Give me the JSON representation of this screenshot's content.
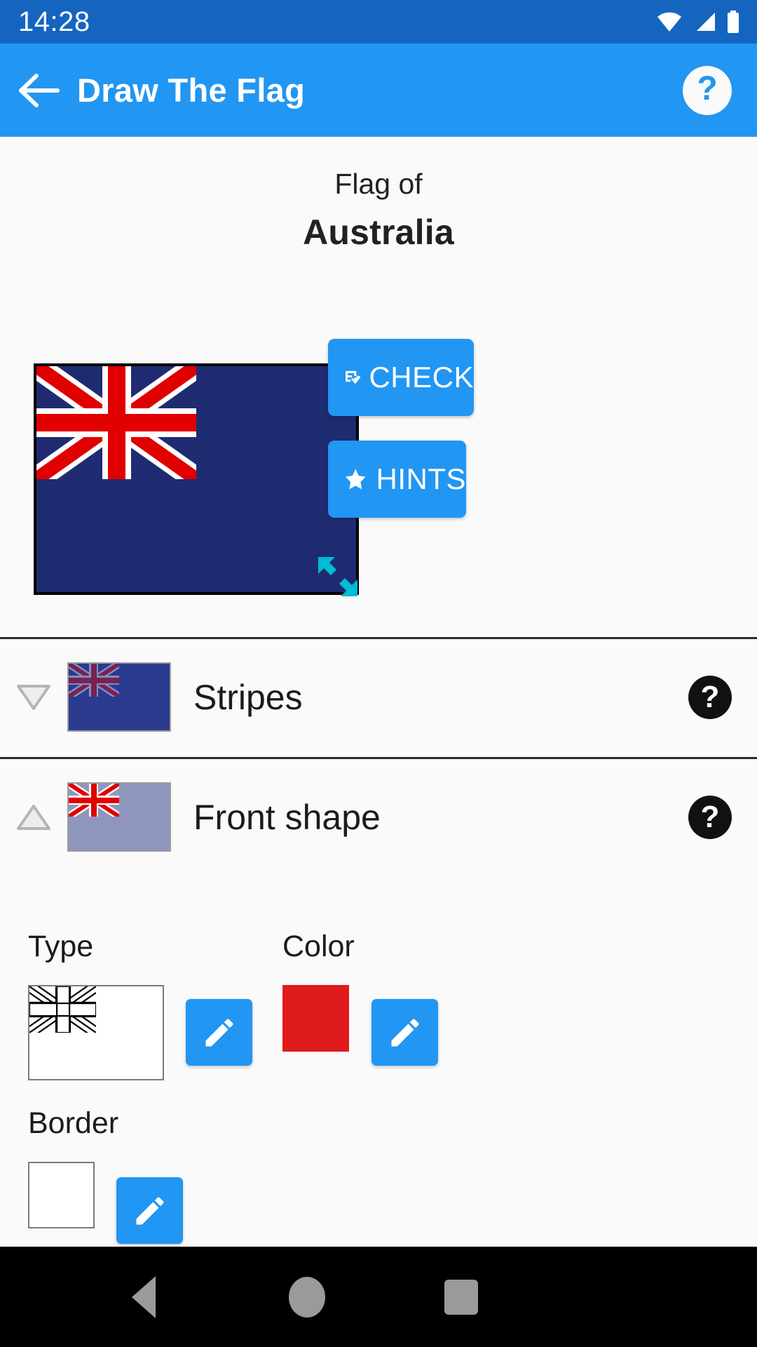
{
  "status_bar": {
    "time": "14:28",
    "icons": [
      "wifi-icon",
      "cellular-signal-icon",
      "battery-icon"
    ]
  },
  "app_bar": {
    "back_icon": "arrow-left-icon",
    "title": "Draw The Flag",
    "help_icon": "question-mark-icon",
    "background_color": "#2196F3"
  },
  "header": {
    "prefix": "Flag of",
    "country": "Australia"
  },
  "canvas": {
    "name": "flag-drawing-canvas",
    "background_color": "#1F2B70",
    "border_color": "#000000",
    "union_jack_red": "#E00000",
    "union_jack_white": "#FFFFFF"
  },
  "actions": {
    "check": {
      "label": "CHECK",
      "icon": "fact-check-icon",
      "color": "#2196F3"
    },
    "hints": {
      "label": "HINTS",
      "icon": "star-icon",
      "color": "#2196F3"
    },
    "resize": {
      "icon": "resize-diagonal-icon",
      "color": "#00BCD4"
    }
  },
  "sections": [
    {
      "id": "stripes",
      "label": "Stripes",
      "chevron": "chevron-down-icon",
      "expanded": false,
      "help_icon": "question-mark-icon",
      "thumb_background": "#2A3B8F",
      "thumb_overlay_opacity": 0.45
    },
    {
      "id": "front-shape",
      "label": "Front shape",
      "chevron": "chevron-up-icon",
      "expanded": true,
      "help_icon": "question-mark-icon",
      "thumb_background": "#8F96BE",
      "thumb_overlay_opacity": 1
    }
  ],
  "front_shape_properties": [
    {
      "id": "type",
      "label": "Type",
      "preview": "union-jack-outline",
      "preview_background": "#FFFFFF",
      "edit_icon": "pencil-icon"
    },
    {
      "id": "color",
      "label": "Color",
      "value": "#E01B1B",
      "edit_icon": "pencil-icon"
    },
    {
      "id": "border",
      "label": "Border",
      "value": "#FFFFFF",
      "edit_icon": "pencil-icon"
    }
  ],
  "nav_bar": {
    "back": "nav-back-icon",
    "home": "nav-home-icon",
    "recents": "nav-recents-icon"
  }
}
